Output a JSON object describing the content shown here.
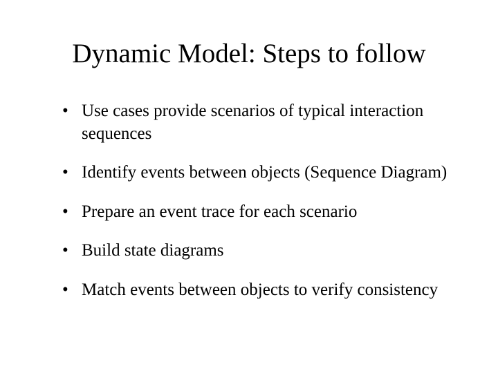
{
  "title": "Dynamic Model: Steps to follow",
  "bullets": [
    "Use cases provide scenarios of typical interaction sequences",
    "Identify events between objects (Sequence Diagram)",
    "Prepare an event trace for each scenario",
    "Build state diagrams",
    "Match events between objects to verify consistency"
  ]
}
